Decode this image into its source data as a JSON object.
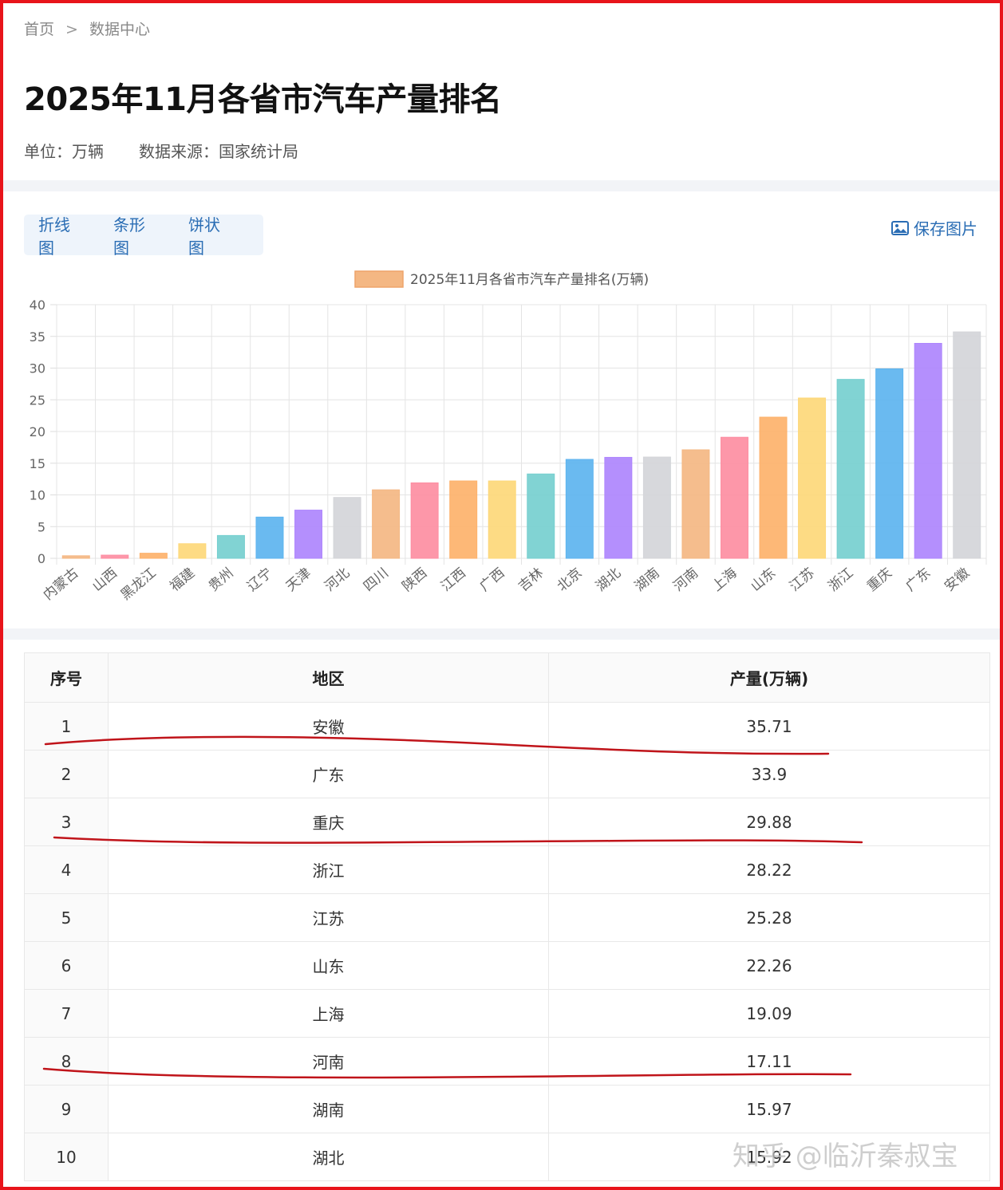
{
  "breadcrumb": {
    "home": "首页",
    "separator": ">",
    "current": "数据中心"
  },
  "page_title": "2025年11月各省市汽车产量排名",
  "meta": {
    "unit": "单位：万辆",
    "source": "数据来源：国家统计局"
  },
  "tabs": [
    {
      "label": "折线图"
    },
    {
      "label": "条形图"
    },
    {
      "label": "饼状图"
    }
  ],
  "save_button": {
    "label": "保存图片",
    "icon": "image-icon"
  },
  "colors": {
    "accent": "#2a6db4",
    "annotation": "#c0141a",
    "frame": "#e8141b"
  },
  "chart_data": {
    "type": "bar",
    "legend": "2025年11月各省市汽车产量排名(万辆)",
    "legend_position": "top-center",
    "grid": true,
    "ylim": [
      0,
      40
    ],
    "yticks": [
      0,
      5,
      10,
      15,
      20,
      25,
      30,
      35,
      40
    ],
    "categories": [
      "内蒙古",
      "山西",
      "黑龙江",
      "福建",
      "贵州",
      "辽宁",
      "天津",
      "河北",
      "四川",
      "陕西",
      "江西",
      "广西",
      "吉林",
      "北京",
      "湖北",
      "湖南",
      "河南",
      "上海",
      "山东",
      "江苏",
      "浙江",
      "重庆",
      "广东",
      "安徽"
    ],
    "values": [
      0.4,
      0.5,
      0.8,
      2.3,
      3.6,
      6.5,
      7.6,
      9.6,
      10.8,
      11.9,
      12.2,
      12.2,
      13.3,
      15.6,
      15.92,
      15.97,
      17.11,
      19.09,
      22.26,
      25.28,
      28.22,
      29.88,
      33.9,
      35.71
    ],
    "bar_colors": [
      "#f4b783",
      "#fd8ea2",
      "#fdb26b",
      "#fdd87a",
      "#76cfcf",
      "#5db4ef",
      "#ae86fd",
      "#d4d5d9"
    ]
  },
  "table": {
    "headers": [
      "序号",
      "地区",
      "产量(万辆)"
    ],
    "rows": [
      [
        "1",
        "安徽",
        "35.71"
      ],
      [
        "2",
        "广东",
        "33.9"
      ],
      [
        "3",
        "重庆",
        "29.88"
      ],
      [
        "4",
        "浙江",
        "28.22"
      ],
      [
        "5",
        "江苏",
        "25.28"
      ],
      [
        "6",
        "山东",
        "22.26"
      ],
      [
        "7",
        "上海",
        "19.09"
      ],
      [
        "8",
        "河南",
        "17.11"
      ],
      [
        "9",
        "湖南",
        "15.97"
      ],
      [
        "10",
        "湖北",
        "15.92"
      ]
    ]
  },
  "watermark": "知乎 @临沂秦叔宝"
}
